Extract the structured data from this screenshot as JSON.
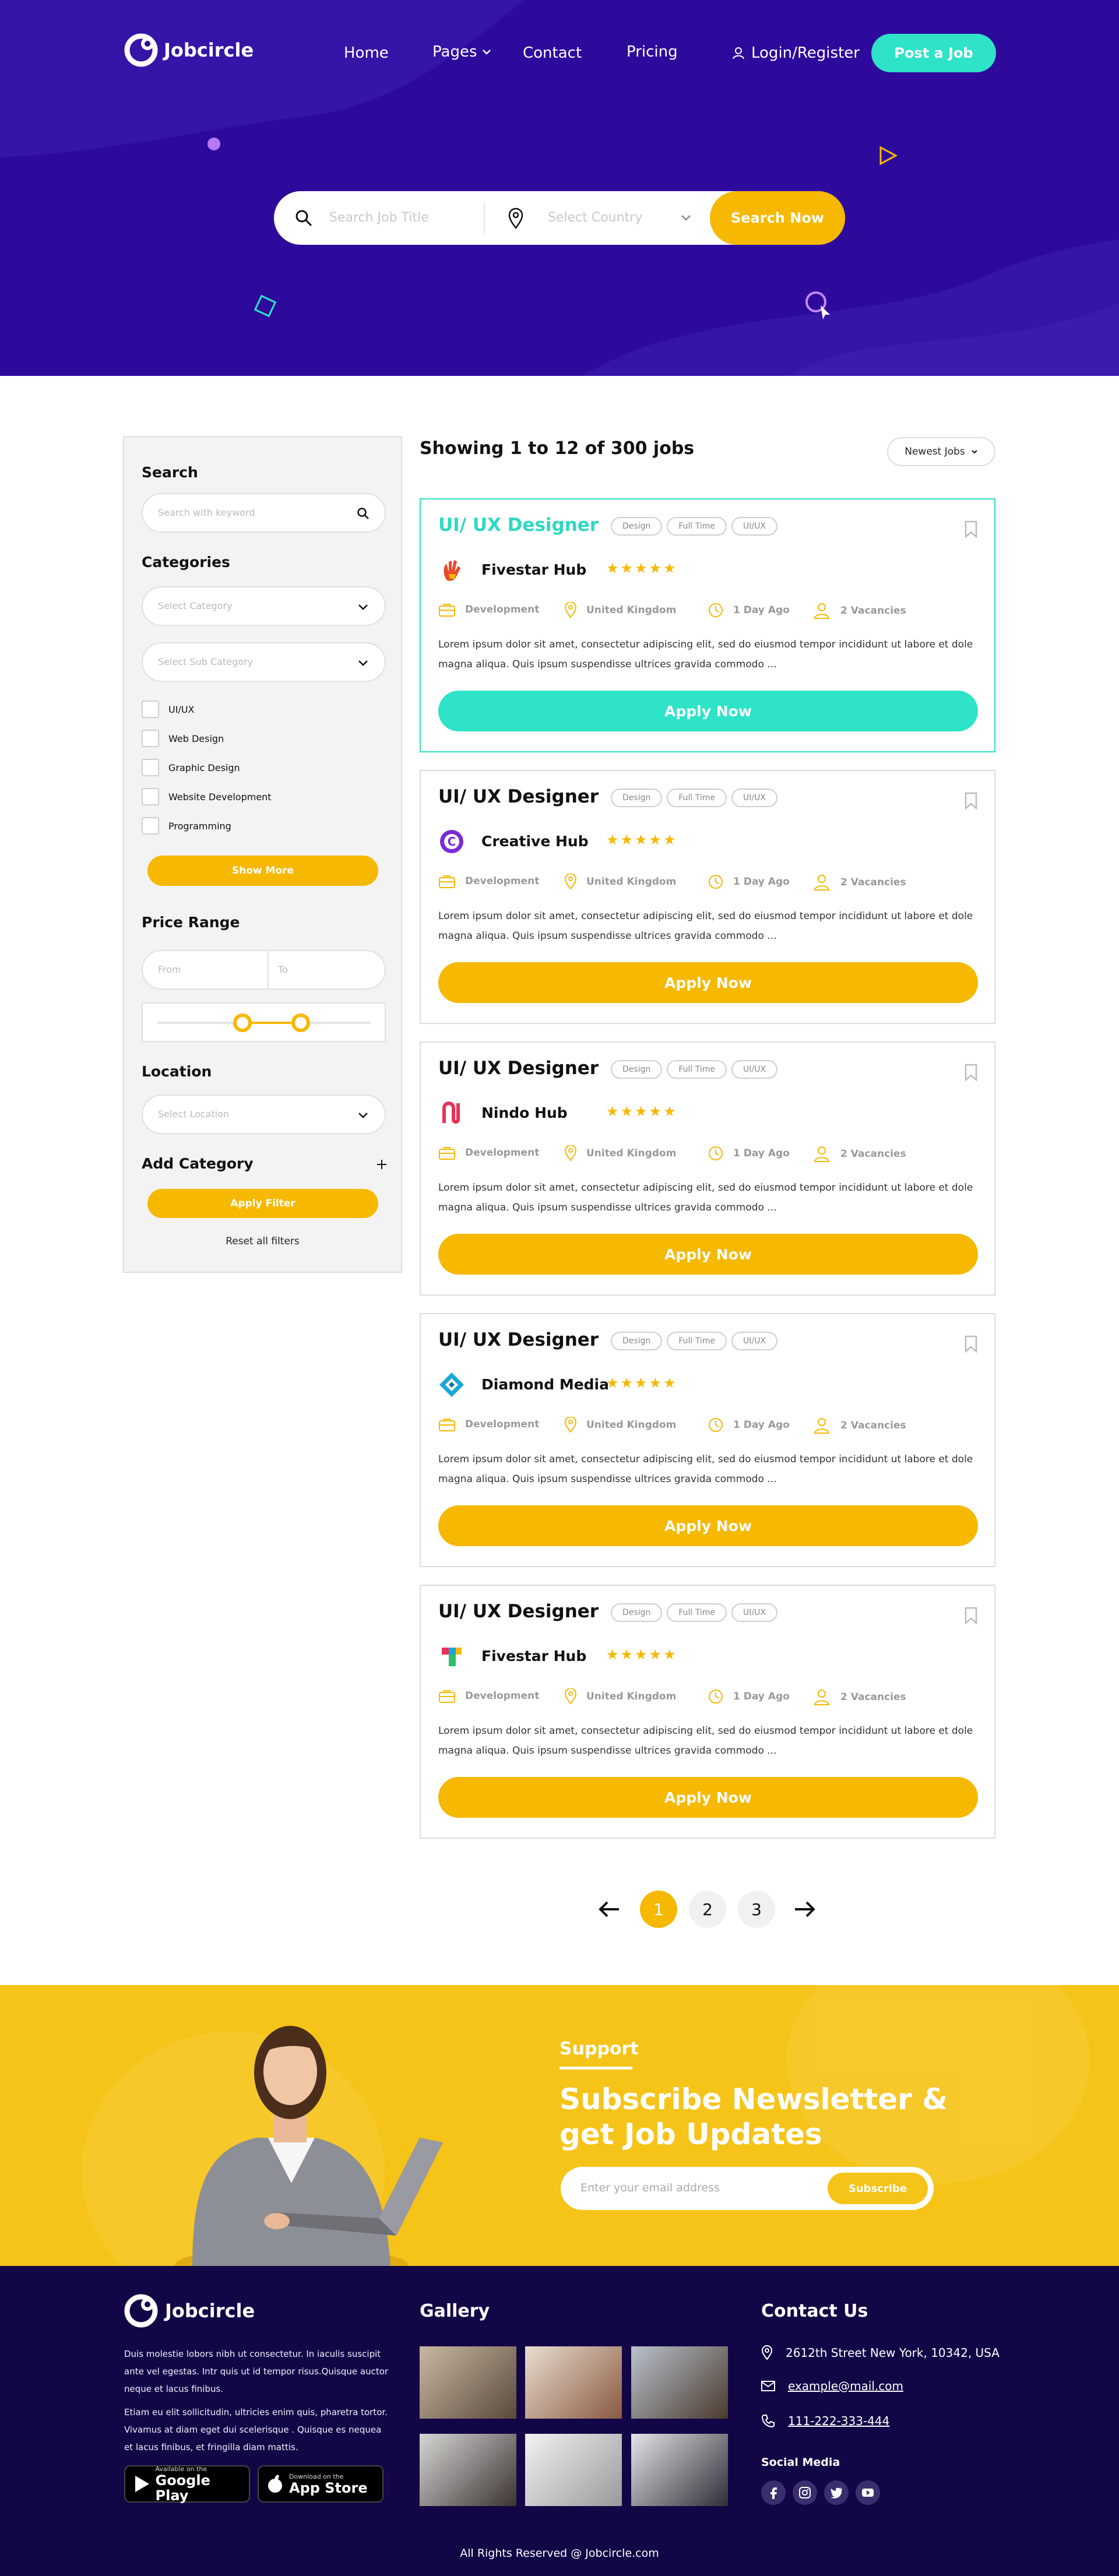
{
  "brand": {
    "name": "Jobcircle",
    "accent": "#2ee3c7",
    "yellow": "#f6b800",
    "hero_bg": "#2e0a9c"
  },
  "nav": {
    "items": [
      "Home",
      "Pages",
      "Contact",
      "Pricing"
    ],
    "login": "Login/Register",
    "post_job": "Post a Job"
  },
  "hero_search": {
    "title_placeholder": "Search Job Title",
    "country_placeholder": "Select Country",
    "button": "Search Now"
  },
  "sidebar": {
    "search_heading": "Search",
    "search_placeholder": "Search with keyword",
    "categories_heading": "Categories",
    "category_placeholder": "Select Category",
    "subcategory_placeholder": "Select Sub Category",
    "checkboxes": [
      "UI/UX",
      "Web Design",
      "Graphic Design",
      "Website Development",
      "Programming"
    ],
    "show_more": "Show More",
    "price_heading": "Price Range",
    "price_from": "From",
    "price_to": "To",
    "price_slider": {
      "low": 0.4,
      "high": 0.67
    },
    "location_heading": "Location",
    "location_placeholder": "Select Location",
    "add_category": "Add Category",
    "apply_filter": "Apply Filter",
    "reset": "Reset all filters"
  },
  "listing": {
    "showing": "Showing 1 to 12 of 300 jobs",
    "sort": "Newest Jobs"
  },
  "jobs": [
    {
      "title": "UI/ UX Designer",
      "tags": [
        "Design",
        "Full Time",
        "UI/UX"
      ],
      "company": "Fivestar Hub",
      "stars": "★★★★★",
      "category": "Development",
      "location": "United Kingdom",
      "posted": "1 Day Ago",
      "vacancies": "2 Vacancies",
      "description": "Lorem ipsum dolor sit amet, consectetur adipiscing elit, sed do eiusmod tempor incididunt ut labore et dole magna aliqua. Quis ipsum suspendisse ultrices gravida commodo ...",
      "apply": "Apply Now"
    },
    {
      "title": "UI/ UX Designer",
      "tags": [
        "Design",
        "Full Time",
        "UI/UX"
      ],
      "company": "Creative Hub",
      "stars": "★★★★★",
      "category": "Development",
      "location": "United Kingdom",
      "posted": "1 Day Ago",
      "vacancies": "2 Vacancies",
      "description": "Lorem ipsum dolor sit amet, consectetur adipiscing elit, sed do eiusmod tempor incididunt ut labore et dole magna aliqua. Quis ipsum suspendisse ultrices gravida commodo ...",
      "apply": "Apply Now"
    },
    {
      "title": "UI/ UX Designer",
      "tags": [
        "Design",
        "Full Time",
        "UI/UX"
      ],
      "company": "Nindo Hub",
      "stars": "★★★★★",
      "category": "Development",
      "location": "United Kingdom",
      "posted": "1 Day Ago",
      "vacancies": "2 Vacancies",
      "description": "Lorem ipsum dolor sit amet, consectetur adipiscing elit, sed do eiusmod tempor incididunt ut labore et dole magna aliqua. Quis ipsum suspendisse ultrices gravida commodo ...",
      "apply": "Apply Now"
    },
    {
      "title": "UI/ UX Designer",
      "tags": [
        "Design",
        "Full Time",
        "UI/UX"
      ],
      "company": "Diamond Media",
      "stars": "★★★★★",
      "category": "Development",
      "location": "United Kingdom",
      "posted": "1 Day Ago",
      "vacancies": "2 Vacancies",
      "description": "Lorem ipsum dolor sit amet, consectetur adipiscing elit, sed do eiusmod tempor incididunt ut labore et dole magna aliqua. Quis ipsum suspendisse ultrices gravida commodo ...",
      "apply": "Apply Now"
    },
    {
      "title": "UI/ UX Designer",
      "tags": [
        "Design",
        "Full Time",
        "UI/UX"
      ],
      "company": "Fivestar Hub",
      "stars": "★★★★★",
      "category": "Development",
      "location": "United Kingdom",
      "posted": "1 Day Ago",
      "vacancies": "2 Vacancies",
      "description": "Lorem ipsum dolor sit amet, consectetur adipiscing elit, sed do eiusmod tempor incididunt ut labore et dole magna aliqua. Quis ipsum suspendisse ultrices gravida commodo ...",
      "apply": "Apply Now"
    }
  ],
  "pagination": {
    "pages": [
      "1",
      "2",
      "3"
    ],
    "current": "1"
  },
  "newsletter": {
    "eyebrow": "Support",
    "title": "Subscribe Newsletter & get Job Updates",
    "placeholder": "Enter your email address",
    "button": "Subscribe"
  },
  "footer": {
    "logo": "Jobcircle",
    "about_1": "Duis molestie lobors nibh ut consectetur. In iaculis suscipit ante vel egestas. Intr quis ut id tempor risus.Quisque auctor neque et lacus finibus.",
    "about_2": "Etiam eu elit sollicitudin, ultricies enim quis, pharetra tortor. Vivamus at diam eget dui scelerisque . Quisque es nequea et lacus finibus, et fringilla diam mattis.",
    "google_small": "Available on the",
    "google_big": "Google Play",
    "apple_small": "Download on the",
    "apple_big": "App Store",
    "gallery_heading": "Gallery",
    "contact_heading": "Contact Us",
    "address": "2612th Street New York, 10342, USA",
    "email": "example@mail.com",
    "phone": "111-222-333-444",
    "social_heading": "Social Media",
    "copyright": "All Rights Reserved @ Jobcircle.com"
  }
}
